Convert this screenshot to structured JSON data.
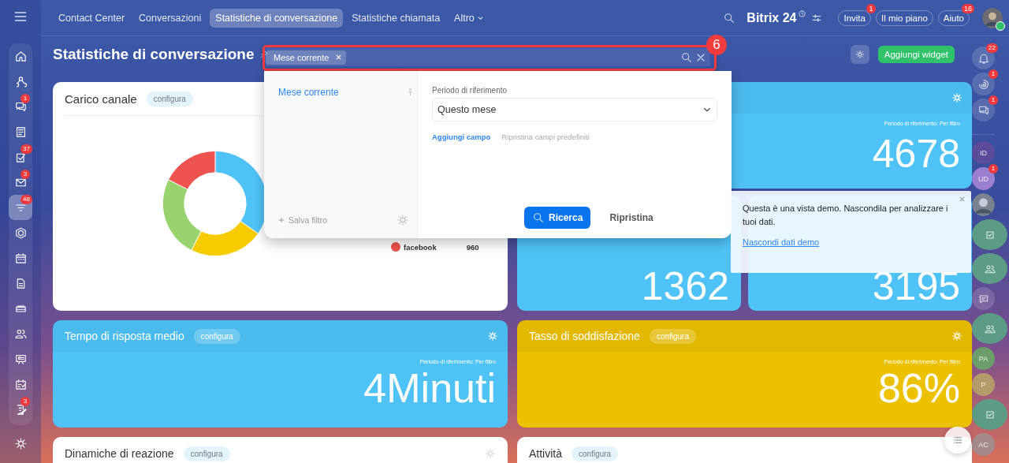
{
  "top_nav": {
    "tabs": [
      {
        "label": "Contact Center",
        "selected": false
      },
      {
        "label": "Conversazioni",
        "selected": false
      },
      {
        "label": "Statistiche di conversazione",
        "selected": true
      },
      {
        "label": "Statistiche chiamata",
        "selected": false
      },
      {
        "label": "Altro",
        "selected": false,
        "kind": "dropdown"
      }
    ]
  },
  "header": {
    "brand": "Bitrix",
    "brand_number": "24",
    "buttons": [
      {
        "label": "Invita",
        "badge": "1"
      },
      {
        "label": "Il mio piano"
      },
      {
        "label": "Aiuto",
        "badge": "16"
      }
    ]
  },
  "left_sidebar": {
    "items": [
      {
        "kind": "home",
        "selected": false
      },
      {
        "kind": "share",
        "selected": false
      },
      {
        "kind": "chat",
        "selected": false,
        "badge": "1"
      },
      {
        "kind": "feed",
        "selected": false
      },
      {
        "kind": "tasks",
        "selected": false,
        "badge": "37"
      },
      {
        "kind": "mail",
        "selected": false,
        "badge": "3"
      },
      {
        "kind": "funnel",
        "selected": true,
        "badge": "48"
      },
      {
        "kind": "hexagon",
        "selected": false
      },
      {
        "kind": "calendar",
        "selected": false
      },
      {
        "kind": "document",
        "selected": false
      },
      {
        "kind": "drive",
        "selected": false
      },
      {
        "kind": "contacts",
        "selected": false
      },
      {
        "kind": "board",
        "selected": false
      },
      {
        "kind": "planner",
        "selected": false
      },
      {
        "kind": "edit",
        "selected": false,
        "badge": "3"
      }
    ]
  },
  "page": {
    "title": "Statistiche di conversazione",
    "filter_chip": "Mese corrente",
    "annotation": "6",
    "add_widget": "Aggiungi widget"
  },
  "filter_popup": {
    "presets": [
      {
        "label": "Mese corrente",
        "selected": true
      }
    ],
    "save_filter": "Salva filtro",
    "field_label": "Periodo di riferimento",
    "field_value": "Questo mese",
    "add_field": "Aggiungi campo",
    "reset_fields": "Ripristina campi predefiniti",
    "search_button": "Ricerca",
    "reset_button": "Ripristina"
  },
  "widgets": {
    "channel_load": {
      "title": "Carico canale",
      "configure": "configura",
      "legend": [
        {
          "label": "facebook",
          "value": "960",
          "color": "#ef5350"
        }
      ]
    },
    "total": {
      "period": "Periodo di riferimento: Per filtro",
      "value": "4678"
    },
    "split": [
      {
        "value": "1362"
      },
      {
        "value": "3195"
      }
    ],
    "row2": [
      {
        "title": "Tempo di risposta medio",
        "configure": "configura",
        "period": "Periodo di riferimento: Per filtro",
        "value": "4Minuti",
        "kind": "blue"
      },
      {
        "title": "Tasso di soddisfazione",
        "configure": "configura",
        "period": "Periodo di riferimento: Per filtro",
        "value": "86%",
        "kind": "yellow"
      }
    ],
    "row3": [
      {
        "title": "Dinamiche di reazione",
        "configure": "configura"
      },
      {
        "title": "Attività",
        "configure": "configura"
      }
    ]
  },
  "demo_notice": {
    "text": "Questa è una vista demo. Nascondila per analizzare i tuoi dati.",
    "link": "Nascondi dati demo"
  },
  "right_bar": {
    "items": [
      {
        "kind": "bell",
        "badge": "22"
      },
      {
        "kind": "spiral",
        "badge": "1"
      },
      {
        "kind": "chat",
        "badge": "1"
      },
      {
        "kind": "initials",
        "initials": "ID",
        "color": "#5c4b9a"
      },
      {
        "kind": "initials",
        "initials": "UD",
        "badge": "1",
        "color": "#9b7fd1"
      },
      {
        "kind": "photo"
      },
      {
        "kind": "task"
      },
      {
        "kind": "group"
      },
      {
        "kind": "message"
      },
      {
        "kind": "group"
      },
      {
        "kind": "initials",
        "initials": "PA",
        "color": "#6b9e6b"
      },
      {
        "kind": "initials",
        "initials": "P",
        "color": "#b59a6a"
      },
      {
        "kind": "task"
      },
      {
        "kind": "initials",
        "initials": "AC",
        "color": "#a58a8a"
      }
    ]
  }
}
